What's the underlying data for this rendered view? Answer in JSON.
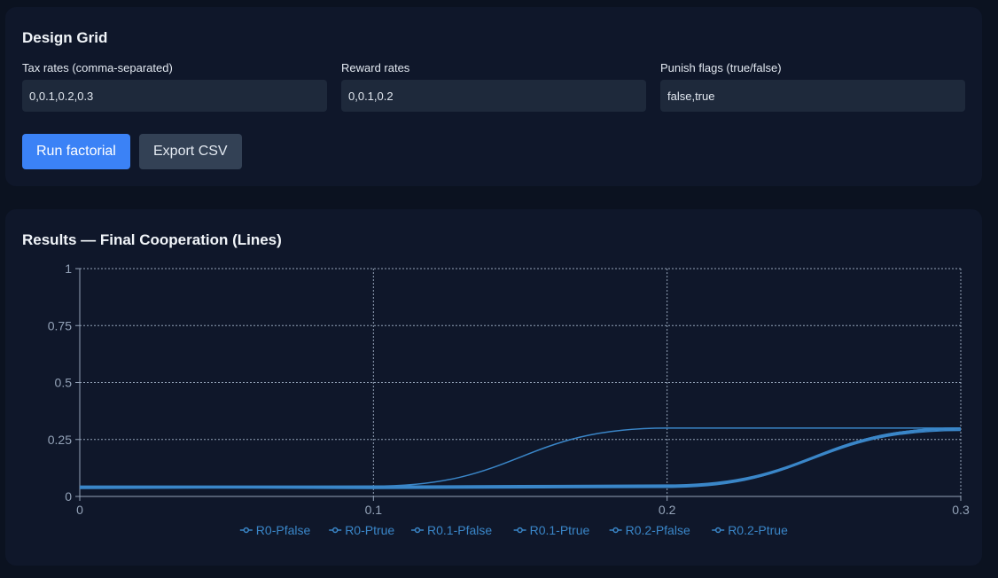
{
  "design_grid": {
    "title": "Design Grid",
    "tax_label": "Tax rates (comma-separated)",
    "tax_value": "0,0.1,0.2,0.3",
    "reward_label": "Reward rates",
    "reward_value": "0,0.1,0.2",
    "punish_label": "Punish flags (true/false)",
    "punish_value": "false,true",
    "run_label": "Run factorial",
    "export_label": "Export CSV"
  },
  "results": {
    "title": "Results — Final Cooperation (Lines)"
  },
  "colors": {
    "accent": "#3b82f6",
    "series": "#3a86c8",
    "grid": "#94a3b8"
  },
  "chart_data": {
    "type": "line",
    "title": "",
    "xlabel": "",
    "ylabel": "",
    "x": [
      0,
      0.1,
      0.2,
      0.3
    ],
    "xticks": [
      "0",
      "0.1",
      "0.2",
      "0.3"
    ],
    "yticks": [
      "0",
      "0.25",
      "0.5",
      "0.75",
      "1"
    ],
    "xlim": [
      0,
      0.3
    ],
    "ylim": [
      0,
      1
    ],
    "grid": true,
    "legend": "bottom-center",
    "series": [
      {
        "name": "R0-Pfalse",
        "values": [
          0.04,
          0.035,
          0.04,
          0.3
        ]
      },
      {
        "name": "R0-Ptrue",
        "values": [
          0.045,
          0.045,
          0.3,
          0.3
        ]
      },
      {
        "name": "R0.1-Pfalse",
        "values": [
          0.035,
          0.04,
          0.045,
          0.29
        ]
      },
      {
        "name": "R0.1-Ptrue",
        "values": [
          0.04,
          0.045,
          0.05,
          0.3
        ]
      },
      {
        "name": "R0.2-Pfalse",
        "values": [
          0.038,
          0.04,
          0.042,
          0.295
        ]
      },
      {
        "name": "R0.2-Ptrue",
        "values": [
          0.042,
          0.038,
          0.048,
          0.3
        ]
      }
    ]
  }
}
